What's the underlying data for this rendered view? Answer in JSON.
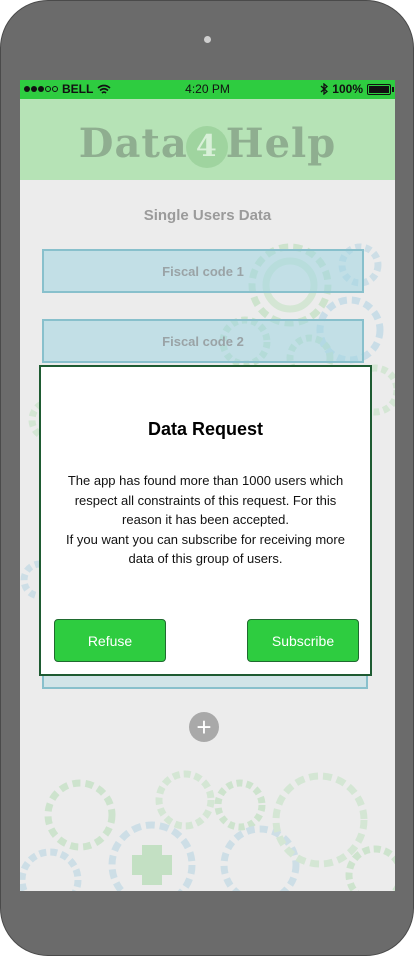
{
  "status_bar": {
    "carrier": "BELL",
    "time": "4:20 PM",
    "battery": "100%",
    "battery_level": 1.0
  },
  "header": {
    "logo_left": "Data",
    "logo_mark": "4",
    "logo_right": "Help"
  },
  "page": {
    "section_title": "Single Users Data",
    "fields": [
      "Fiscal code 1",
      "Fiscal code 2"
    ],
    "add_label": "+"
  },
  "dialog": {
    "title": "Data Request",
    "line1": "The app has found more than 1000 users which respect all constraints of this request. For this reason it has been accepted.",
    "line2": "If you want you can subscribe for receiving more data of this group of users.",
    "refuse_label": "Refuse",
    "subscribe_label": "Subscribe"
  },
  "colors": {
    "accent": "#2ecc40",
    "header_bg": "#b6e3b6",
    "dialog_border": "#1e5b32"
  }
}
